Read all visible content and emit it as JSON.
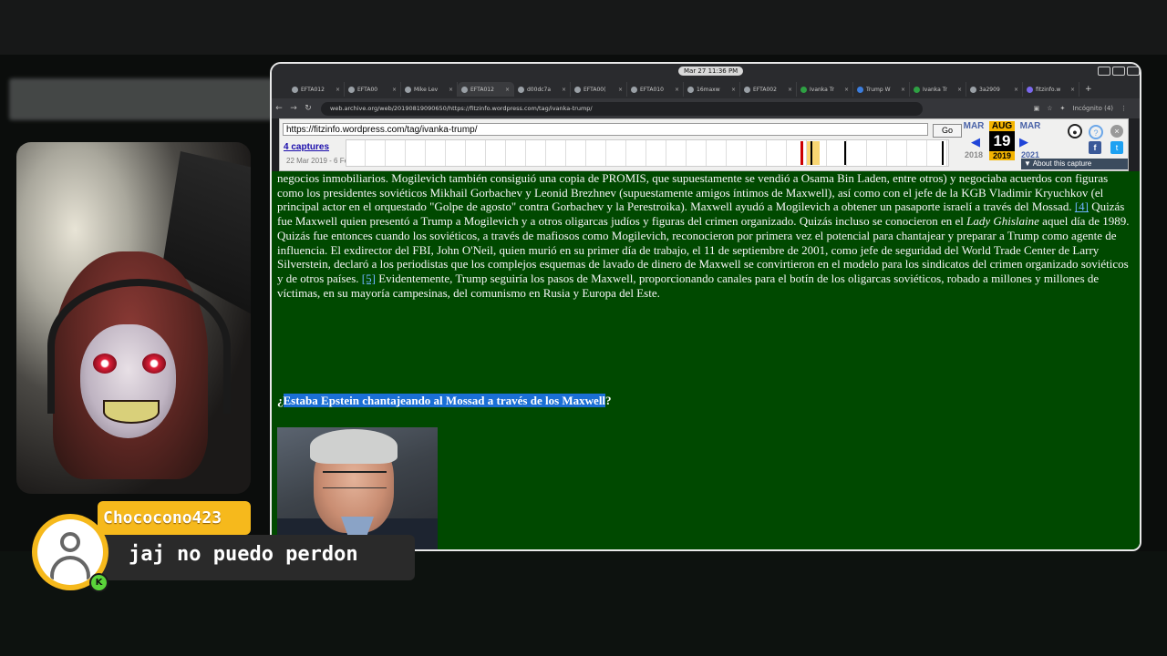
{
  "browser": {
    "clock": "Mar 27  11:36 PM",
    "tabs": [
      {
        "label": "EFTA012"
      },
      {
        "label": "EFTA00"
      },
      {
        "label": "Mike Lev"
      },
      {
        "label": "EFTA012"
      },
      {
        "label": "d00dc7a"
      },
      {
        "label": "EFTA00("
      },
      {
        "label": "EFTA010"
      },
      {
        "label": "16maxw"
      },
      {
        "label": "EFTA002"
      },
      {
        "label": "Ivanka Tr"
      },
      {
        "label": "Trump W"
      },
      {
        "label": "Ivanka Tr"
      },
      {
        "label": "3a2909"
      },
      {
        "label": "fitzinfo.w"
      }
    ],
    "address": "web.archive.org/web/20190819090650/https://fitzinfo.wordpress.com/tag/ivanka-trump/",
    "incognito": "Incógnito (4)"
  },
  "wayback": {
    "url": "https://fitzinfo.wordpress.com/tag/ivanka-trump/",
    "go": "Go",
    "captures": "4 captures",
    "range": "22 Mar 2019 - 6 Fe",
    "prev_month": "MAR",
    "cur_month": "AUG",
    "next_month": "MAR",
    "day": "19",
    "prev_year": "2018",
    "cur_year": "2019",
    "next_year": "2021",
    "about": "▼ About this capture"
  },
  "article": {
    "p1_a": "negocios inmobiliarios. Mogilevich también consiguió una copia de PROMIS, que supuestamente se vendió a Osama Bin Laden, entre otros) y negociaba acuerdos con figuras como los presidentes soviéticos Mikhail Gorbachev y Leonid Brezhnev (supuestamente amigos íntimos de Maxwell), así como con el jefe de la KGB Vladimir Kryuchkov (el principal actor en el orquestado \"Golpe de agosto\" contra Gorbachev y la Perestroika). Maxwell ayudó a Mogilevich a obtener un pasaporte israelí a través del Mossad. ",
    "ref4": "[4]",
    "p1_b": " Quizás fue Maxwell quien presentó a Trump a Mogilevich y a otros oligarcas judíos y figuras del crimen organizado. Quizás incluso se conocieron en el ",
    "italic": "Lady Ghislaine",
    "p1_c": " aquel día de 1989. Quizás fue entonces cuando los soviéticos, a través de mafiosos como Mogilevich, reconocieron por primera vez el potencial para chantajear y preparar a Trump como agente de influencia. El exdirector del FBI, John O'Neil, quien murió en su primer día de trabajo, el 11 de septiembre de 2001, como jefe de seguridad del World Trade Center de Larry Silverstein, declaró a los periodistas que los complejos esquemas de lavado de dinero de Maxwell se convirtieron en el modelo para los sindicatos del crimen organizado soviéticos y de otros países. ",
    "ref5": "[5]",
    "p1_d": " Evidentemente, Trump seguiría los pasos de Maxwell, proporcionando canales para el botín de los oligarcas soviéticos, robado a millones y millones de víctimas, en su mayoría campesinas, del comunismo en Rusia y Europa del Este.",
    "heading_open": "¿",
    "heading_sel": "Estaba Epstein chantajeando al Mossad a través de los Maxwell",
    "heading_close": "?"
  },
  "chat": {
    "username": "Chococono423",
    "message": "jaj no puedo perdon",
    "badge": "K"
  }
}
